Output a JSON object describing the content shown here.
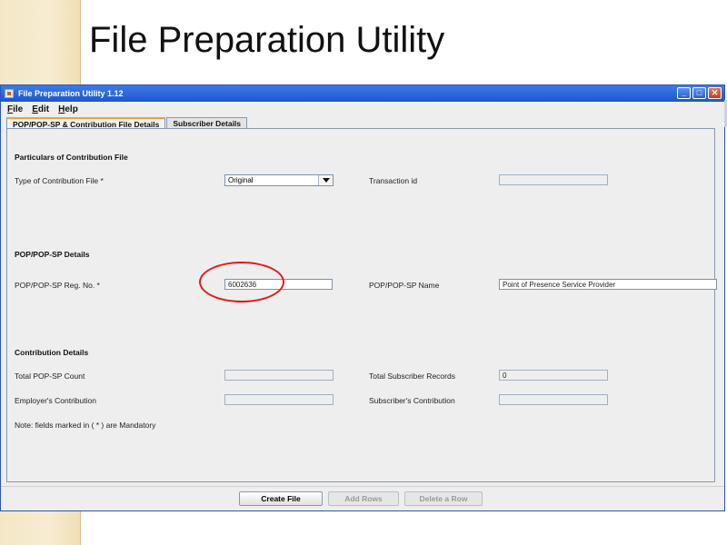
{
  "slide": {
    "title": "File Preparation Utility"
  },
  "window": {
    "title": "File Preparation Utility 1.12",
    "menus": [
      "File",
      "Edit",
      "Help"
    ],
    "tabs": [
      {
        "label": "POP/POP-SP & Contribution File Details",
        "active": true
      },
      {
        "label": "Subscriber Details",
        "active": false
      }
    ],
    "sections": {
      "particulars": {
        "heading": "Particulars of Contribution File",
        "type_label": "Type of Contribution File *",
        "type_value": "Original",
        "transaction_label": "Transaction id",
        "transaction_value": ""
      },
      "pop": {
        "heading": "POP/POP-SP Details",
        "reg_label": "POP/POP-SP Reg. No. *",
        "reg_value": "6002636",
        "name_label": "POP/POP-SP Name",
        "name_value": "Point of Presence Service Provider"
      },
      "contribution": {
        "heading": "Contribution Details",
        "total_pop_label": "Total POP-SP Count",
        "total_pop_value": "",
        "total_sub_label": "Total Subscriber Records",
        "total_sub_value": "0",
        "employer_label": "Employer's Contribution",
        "employer_value": "",
        "subscriber_label": "Subscriber's Contribution",
        "subscriber_value": "",
        "note": "Note: fields marked in ( * ) are Mandatory"
      }
    },
    "buttons": {
      "create": "Create File",
      "add": "Add Rows",
      "delete": "Delete a Row"
    }
  },
  "colors": {
    "title_bar": "#1e56c9",
    "highlight": "#e11b1b",
    "active_tab_accent": "#f0a030"
  }
}
